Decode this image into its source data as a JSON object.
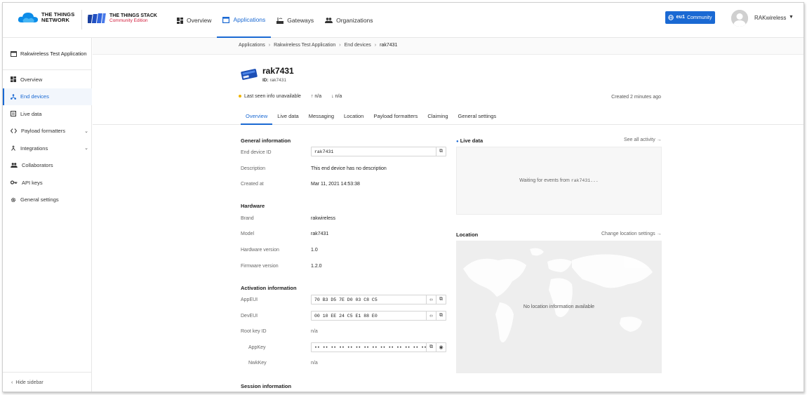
{
  "header": {
    "ttn_logo_line1": "THE THINGS",
    "ttn_logo_line2": "NETWORK",
    "stack_line1": "THE THINGS STACK",
    "stack_line2": "Community Edition",
    "nav": [
      {
        "label": "Overview",
        "icon": "grid-icon"
      },
      {
        "label": "Applications",
        "icon": "window-icon"
      },
      {
        "label": "Gateways",
        "icon": "gateway-icon"
      },
      {
        "label": "Organizations",
        "icon": "people-icon"
      }
    ],
    "cluster_code": "eu1",
    "cluster_label": "Community",
    "user_name": "RAKwireless",
    "accent": "#1a69d3"
  },
  "sidebar": {
    "app_title": "Rakwireless Test Application",
    "items": [
      {
        "label": "Overview",
        "icon": "grid-icon"
      },
      {
        "label": "End devices",
        "icon": "devices-icon"
      },
      {
        "label": "Live data",
        "icon": "list-icon"
      },
      {
        "label": "Payload formatters",
        "icon": "code-icon"
      },
      {
        "label": "Integrations",
        "icon": "integration-icon"
      },
      {
        "label": "Collaborators",
        "icon": "people-icon"
      },
      {
        "label": "API keys",
        "icon": "key-icon"
      },
      {
        "label": "General settings",
        "icon": "gear-icon"
      }
    ],
    "hide_label": "Hide sidebar"
  },
  "breadcrumb": [
    "Applications",
    "Rakwireless Test Application",
    "End devices",
    "rak7431"
  ],
  "device": {
    "name": "rak7431",
    "id_label": "ID:",
    "id_value": "rak7431",
    "last_seen": "Last seen info unavailable",
    "uplink": "n/a",
    "downlink": "n/a",
    "created_ago": "Created 2 minutes ago"
  },
  "tabs": [
    "Overview",
    "Live data",
    "Messaging",
    "Location",
    "Payload formatters",
    "Claiming",
    "General settings"
  ],
  "general": {
    "title": "General information",
    "end_device_id_label": "End device ID",
    "end_device_id": "rak7431",
    "description_label": "Description",
    "description": "This end device has no description",
    "created_at_label": "Created at",
    "created_at": "Mar 11, 2021 14:53:38"
  },
  "hardware": {
    "title": "Hardware",
    "brand_label": "Brand",
    "brand": "rakwireless",
    "model_label": "Model",
    "model": "rak7431",
    "hw_label": "Hardware version",
    "hw": "1.0",
    "fw_label": "Firmware version",
    "fw": "1.2.0"
  },
  "activation": {
    "title": "Activation information",
    "appeui_label": "AppEUI",
    "appeui": "70 B3 D5 7E D0 03 C8 C5",
    "deveui_label": "DevEUI",
    "deveui": "00 10 EE 24 C5 E1 88 E0",
    "root_key_label": "Root key ID",
    "root_key": "n/a",
    "appkey_label": "AppKey",
    "appkey": "•• •• •• •• •• •• •• •• •• •• •• •• •• •• •• ••",
    "nwkkey_label": "NwkKey",
    "nwkkey": "n/a"
  },
  "session": {
    "title": "Session information"
  },
  "live_panel": {
    "title": "Live data",
    "link": "See all activity →",
    "waiting_prefix": "Waiting for events from",
    "waiting_device": "rak7431..."
  },
  "location_panel": {
    "title": "Location",
    "link": "Change location settings →",
    "empty": "No location information available"
  }
}
